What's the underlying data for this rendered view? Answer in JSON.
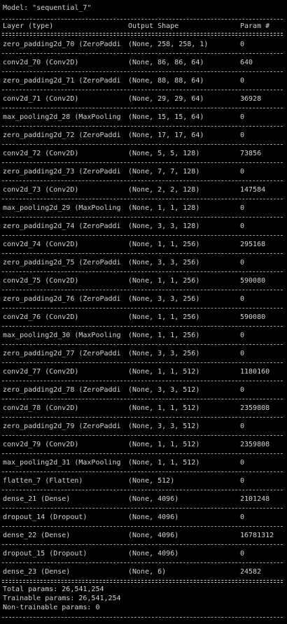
{
  "model_title": "Model: \"sequential_7\"",
  "table": {
    "headers": {
      "layer": "Layer (type)",
      "shape": "Output Shape",
      "params": "Param #"
    },
    "rows": [
      {
        "layer": "zero_padding2d_70 (ZeroPaddi",
        "shape": "(None, 258, 258, 1)",
        "params": "0"
      },
      {
        "layer": "conv2d_70 (Conv2D)",
        "shape": "(None, 86, 86, 64)",
        "params": "640"
      },
      {
        "layer": "zero_padding2d_71 (ZeroPaddi",
        "shape": "(None, 88, 88, 64)",
        "params": "0"
      },
      {
        "layer": "conv2d_71 (Conv2D)",
        "shape": "(None, 29, 29, 64)",
        "params": "36928"
      },
      {
        "layer": "max_pooling2d_28 (MaxPooling",
        "shape": "(None, 15, 15, 64)",
        "params": "0"
      },
      {
        "layer": "zero_padding2d_72 (ZeroPaddi",
        "shape": "(None, 17, 17, 64)",
        "params": "0"
      },
      {
        "layer": "conv2d_72 (Conv2D)",
        "shape": "(None, 5, 5, 128)",
        "params": "73856"
      },
      {
        "layer": "zero_padding2d_73 (ZeroPaddi",
        "shape": "(None, 7, 7, 128)",
        "params": "0"
      },
      {
        "layer": "conv2d_73 (Conv2D)",
        "shape": "(None, 2, 2, 128)",
        "params": "147584"
      },
      {
        "layer": "max_pooling2d_29 (MaxPooling",
        "shape": "(None, 1, 1, 128)",
        "params": "0"
      },
      {
        "layer": "zero_padding2d_74 (ZeroPaddi",
        "shape": "(None, 3, 3, 128)",
        "params": "0"
      },
      {
        "layer": "conv2d_74 (Conv2D)",
        "shape": "(None, 1, 1, 256)",
        "params": "295168"
      },
      {
        "layer": "zero_padding2d_75 (ZeroPaddi",
        "shape": "(None, 3, 3, 256)",
        "params": "0"
      },
      {
        "layer": "conv2d_75 (Conv2D)",
        "shape": "(None, 1, 1, 256)",
        "params": "590080"
      },
      {
        "layer": "zero_padding2d_76 (ZeroPaddi",
        "shape": "(None, 3, 3, 256)",
        "params": "0"
      },
      {
        "layer": "conv2d_76 (Conv2D)",
        "shape": "(None, 1, 1, 256)",
        "params": "590080"
      },
      {
        "layer": "max_pooling2d_30 (MaxPooling",
        "shape": "(None, 1, 1, 256)",
        "params": "0"
      },
      {
        "layer": "zero_padding2d_77 (ZeroPaddi",
        "shape": "(None, 3, 3, 256)",
        "params": "0"
      },
      {
        "layer": "conv2d_77 (Conv2D)",
        "shape": "(None, 1, 1, 512)",
        "params": "1180160"
      },
      {
        "layer": "zero_padding2d_78 (ZeroPaddi",
        "shape": "(None, 3, 3, 512)",
        "params": "0"
      },
      {
        "layer": "conv2d_78 (Conv2D)",
        "shape": "(None, 1, 1, 512)",
        "params": "2359808"
      },
      {
        "layer": "zero_padding2d_79 (ZeroPaddi",
        "shape": "(None, 3, 3, 512)",
        "params": "0"
      },
      {
        "layer": "conv2d_79 (Conv2D)",
        "shape": "(None, 1, 1, 512)",
        "params": "2359808"
      },
      {
        "layer": "max_pooling2d_31 (MaxPooling",
        "shape": "(None, 1, 1, 512)",
        "params": "0"
      },
      {
        "layer": "flatten_7 (Flatten)",
        "shape": "(None, 512)",
        "params": "0"
      },
      {
        "layer": "dense_21 (Dense)",
        "shape": "(None, 4096)",
        "params": "2101248"
      },
      {
        "layer": "dropout_14 (Dropout)",
        "shape": "(None, 4096)",
        "params": "0"
      },
      {
        "layer": "dense_22 (Dense)",
        "shape": "(None, 4096)",
        "params": "16781312"
      },
      {
        "layer": "dropout_15 (Dropout)",
        "shape": "(None, 4096)",
        "params": "0"
      },
      {
        "layer": "dense_23 (Dense)",
        "shape": "(None, 6)",
        "params": "24582"
      }
    ]
  },
  "summary": {
    "total": "Total params: 26,541,254",
    "trainable": "Trainable params: 26,541,254",
    "non_trainable": "Non-trainable params: 0"
  },
  "colors": {
    "background": "#000000",
    "text": "#d4d4d4"
  }
}
